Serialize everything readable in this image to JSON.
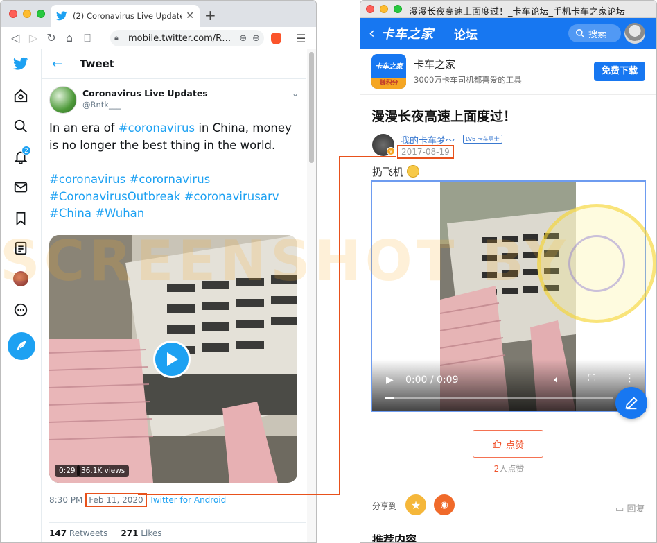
{
  "left_browser": {
    "tab_title": "(2) Coronavirus Live Updates on T",
    "url": "mobile.twitter.com/R…",
    "tweet_header": "Tweet",
    "author_name": "Coronavirus Live Updates",
    "author_handle": "@Rntk___",
    "tweet_text_1": "In an era of ",
    "tweet_hashtag_inline": "#coronavirus",
    "tweet_text_2": " in China, money is no longer the best thing in the world.",
    "tweet_tags_line1": "#coronavirus #corornavirus",
    "tweet_tags_line2": "#CoronavirusOutbreak #coronavirusarv",
    "tweet_tags_line3": "#China #Wuhan",
    "video_duration": "0:29",
    "video_views": "36.1K views",
    "time": "8:30 PM",
    "date": "Feb 11, 2020",
    "source": "Twitter for Android",
    "retweets_count": "147",
    "retweets_label": "Retweets",
    "likes_count": "271",
    "likes_label": "Likes",
    "notification_count": "2"
  },
  "right_window": {
    "window_title": "漫漫长夜高速上面度过！_卡车论坛_手机卡车之家论坛",
    "brand": "卡车之家",
    "section": "论坛",
    "search_label": "搜索",
    "app_icon_name": "卡车之家",
    "app_icon_badge": "赚积分",
    "app_name": "卡车之家",
    "app_desc": "3000万卡车司机都喜爱的工具",
    "download_label": "免费下载",
    "post_title": "漫漫长夜高速上面度过！",
    "author_name": "我的卡车梦～",
    "author_level": "LV6 卡车勇士",
    "post_date": "2017-08-19",
    "post_body": "扔飞机",
    "video_time": "0:00 / 0:09",
    "like_label": "点赞",
    "likes_count": "2",
    "likes_suffix": "人点赞",
    "share_label": "分享到",
    "reply_label": "回复",
    "recommend_label": "推荐内容"
  },
  "watermark_text": "SCREENSHOT BY",
  "colors": {
    "twitter_blue": "#1da1f2",
    "truckhome_blue": "#1777f1",
    "highlight_orange": "#e8511b",
    "like_red": "#f0522b"
  }
}
